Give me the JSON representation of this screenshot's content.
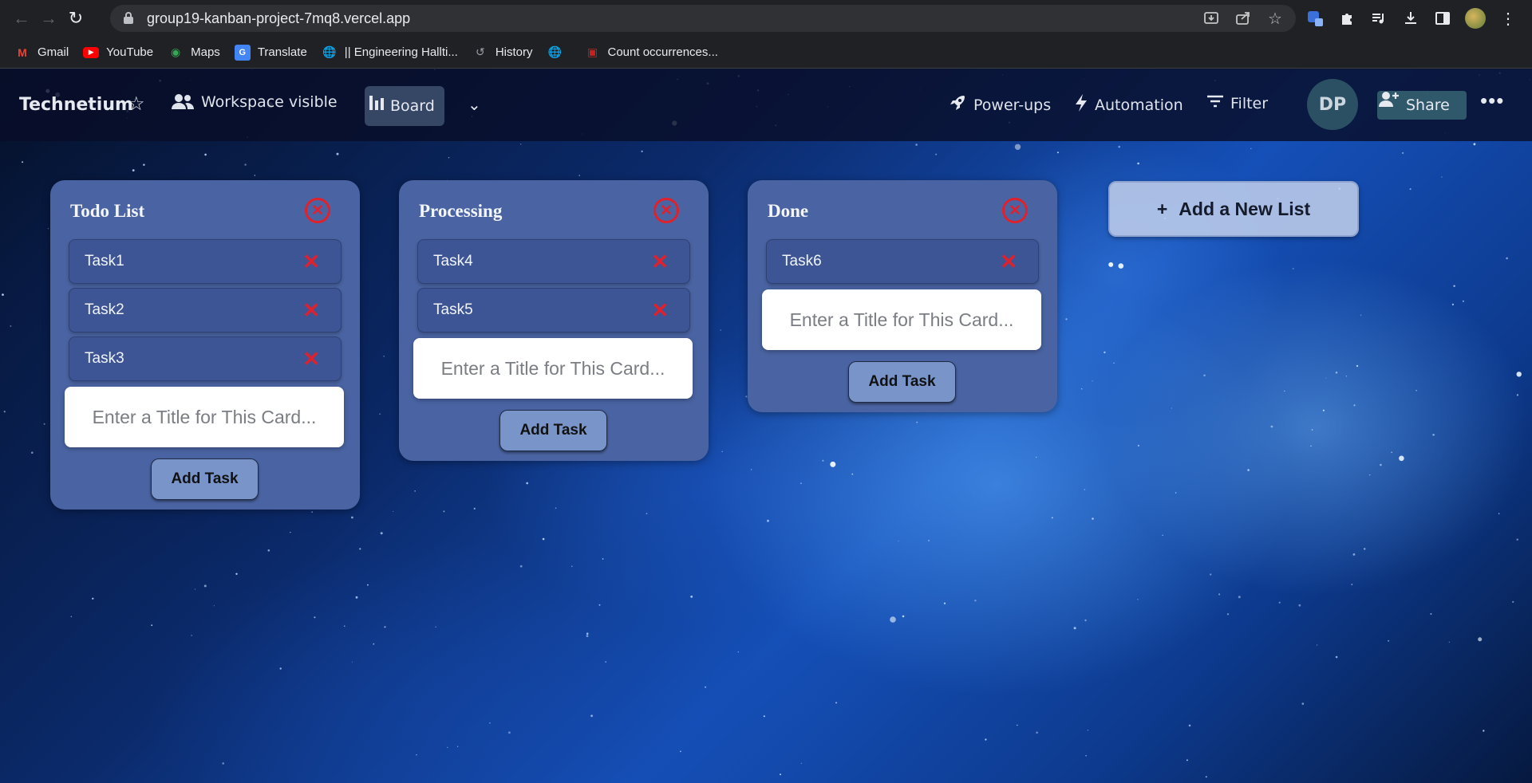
{
  "browser": {
    "url": "group19-kanban-project-7mq8.vercel.app",
    "bookmarks": [
      {
        "label": "Gmail",
        "icon": "gmail-icon"
      },
      {
        "label": "YouTube",
        "icon": "youtube-icon"
      },
      {
        "label": "Maps",
        "icon": "maps-icon"
      },
      {
        "label": "Translate",
        "icon": "translate-icon"
      },
      {
        "label": "|| Engineering Hallti...",
        "icon": "globe-icon"
      },
      {
        "label": "History",
        "icon": "history-icon"
      },
      {
        "label": "",
        "icon": "globe-icon"
      },
      {
        "label": "Count occurrences...",
        "icon": "site-icon"
      }
    ]
  },
  "header": {
    "board_name": "Technetium",
    "visibility": "Workspace visible",
    "view": "Board",
    "powerups": "Power-ups",
    "automation": "Automation",
    "filter": "Filter",
    "avatar_initials": "DP",
    "share": "Share"
  },
  "lists": [
    {
      "title": "Todo List",
      "cards": [
        "Task1",
        "Task2",
        "Task3"
      ],
      "placeholder": "Enter a Title for This Card...",
      "add_label": "Add Task"
    },
    {
      "title": "Processing",
      "cards": [
        "Task4",
        "Task5"
      ],
      "placeholder": "Enter a Title for This Card...",
      "add_label": "Add Task"
    },
    {
      "title": "Done",
      "cards": [
        "Task6"
      ],
      "placeholder": "Enter a Title for This Card...",
      "add_label": "Add Task"
    }
  ],
  "add_list_label": "Add a New List",
  "colors": {
    "list_bg": "#4a64a3",
    "card_bg": "#3d5594",
    "delete_red": "#e0212c",
    "add_task_bg": "#7894c8"
  }
}
